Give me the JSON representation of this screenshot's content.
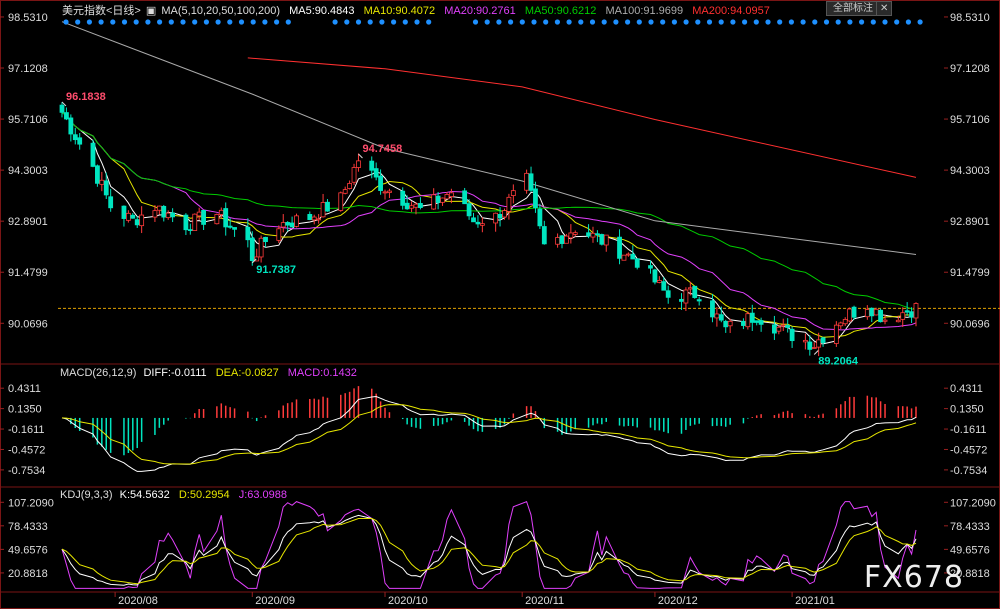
{
  "main_header": {
    "title": "美元指数<日线>",
    "ma_label": "MA(5,10,20,50,100,200)",
    "ma5": "MA5:90.4843",
    "ma10": "MA10:90.4072",
    "ma20": "MA20:90.2761",
    "ma50": "MA50:90.6212",
    "ma100": "MA100:91.9699",
    "ma200": "MA200:94.0957"
  },
  "toolbar": {
    "full_label": "全部标注"
  },
  "macd_header": {
    "label": "MACD(26,12,9)",
    "diff": "DIFF:-0.0111",
    "dea": "DEA:-0.0827",
    "macd": "MACD:0.1432"
  },
  "kdj_header": {
    "label": "KDJ(9,3,3)",
    "k": "K:54.5632",
    "d": "D:50.2954",
    "j": "J:63.0988"
  },
  "watermark": "FX678",
  "colors": {
    "up": "#ff3b3b",
    "down": "#00e5c0",
    "ma5": "#ffffff",
    "ma10": "#e6e600",
    "ma20": "#e040fb",
    "ma50": "#00cc00",
    "ma100": "#aaaaaa",
    "ma200": "#ff3030",
    "last_line": "#e0a000",
    "dots": "#1e90ff"
  },
  "chart_data": [
    {
      "type": "candlestick",
      "title": "美元指数<日线>",
      "y_ticks": [
        "98.5310",
        "97.1208",
        "95.7106",
        "94.3003",
        "92.8901",
        "91.4799",
        "90.0696"
      ],
      "ylim": [
        89.0,
        98.53
      ],
      "x_ticks": [
        "2020/08",
        "2020/09",
        "2020/10",
        "2020/11",
        "2020/12",
        "2021/01"
      ],
      "annotations": [
        {
          "text": "96.1838",
          "value": 96.1838,
          "date": "2020-07-20"
        },
        {
          "text": "94.7458",
          "value": 94.7458,
          "date": "2020-09-25"
        },
        {
          "text": "91.7387",
          "value": 91.7387,
          "date": "2020-09-01"
        },
        {
          "text": "89.2064",
          "value": 89.2064,
          "date": "2021-01-06"
        }
      ],
      "last_price": 90.48,
      "close_series": [
        {
          "date": "2020-07-20",
          "value": 95.9
        },
        {
          "date": "2020-07-27",
          "value": 94.4
        },
        {
          "date": "2020-07-31",
          "value": 93.3
        },
        {
          "date": "2020-08-05",
          "value": 92.9
        },
        {
          "date": "2020-08-10",
          "value": 93.3
        },
        {
          "date": "2020-08-17",
          "value": 92.8
        },
        {
          "date": "2020-08-24",
          "value": 93.1
        },
        {
          "date": "2020-08-31",
          "value": 92.3
        },
        {
          "date": "2020-09-01",
          "value": 91.9
        },
        {
          "date": "2020-09-07",
          "value": 92.8
        },
        {
          "date": "2020-09-14",
          "value": 93.0
        },
        {
          "date": "2020-09-21",
          "value": 93.5
        },
        {
          "date": "2020-09-25",
          "value": 94.6
        },
        {
          "date": "2020-09-30",
          "value": 93.9
        },
        {
          "date": "2020-10-09",
          "value": 93.2
        },
        {
          "date": "2020-10-16",
          "value": 93.7
        },
        {
          "date": "2020-10-21",
          "value": 92.9
        },
        {
          "date": "2020-10-26",
          "value": 93.0
        },
        {
          "date": "2020-11-02",
          "value": 94.0
        },
        {
          "date": "2020-11-06",
          "value": 92.2
        },
        {
          "date": "2020-11-13",
          "value": 92.7
        },
        {
          "date": "2020-11-20",
          "value": 92.3
        },
        {
          "date": "2020-11-27",
          "value": 91.8
        },
        {
          "date": "2020-12-04",
          "value": 90.8
        },
        {
          "date": "2020-12-11",
          "value": 90.9
        },
        {
          "date": "2020-12-17",
          "value": 89.9
        },
        {
          "date": "2020-12-24",
          "value": 90.3
        },
        {
          "date": "2020-12-31",
          "value": 89.8
        },
        {
          "date": "2021-01-06",
          "value": 89.5
        },
        {
          "date": "2021-01-12",
          "value": 90.2
        },
        {
          "date": "2021-01-18",
          "value": 90.6
        },
        {
          "date": "2021-01-22",
          "value": 90.2
        },
        {
          "date": "2021-01-29",
          "value": 90.5
        }
      ],
      "series": [
        {
          "name": "MA5",
          "color": "#ffffff"
        },
        {
          "name": "MA10",
          "color": "#e6e600"
        },
        {
          "name": "MA20",
          "color": "#e040fb"
        },
        {
          "name": "MA50",
          "color": "#00cc00"
        },
        {
          "name": "MA100",
          "color": "#aaaaaa",
          "values": [
            {
              "date": "2020-07-20",
              "value": 98.4
            },
            {
              "date": "2020-09-01",
              "value": 96.4
            },
            {
              "date": "2020-10-01",
              "value": 94.9
            },
            {
              "date": "2020-11-01",
              "value": 94.0
            },
            {
              "date": "2020-12-01",
              "value": 92.9
            },
            {
              "date": "2021-01-29",
              "value": 91.97
            }
          ]
        },
        {
          "name": "MA200",
          "color": "#ff3030",
          "values": [
            {
              "date": "2020-08-31",
              "value": 97.4
            },
            {
              "date": "2020-10-01",
              "value": 97.1
            },
            {
              "date": "2020-11-01",
              "value": 96.6
            },
            {
              "date": "2020-12-01",
              "value": 95.7
            },
            {
              "date": "2021-01-29",
              "value": 94.1
            }
          ]
        }
      ]
    },
    {
      "type": "bar",
      "title": "MACD(26,12,9)",
      "y_ticks": [
        "0.4311",
        "0.1350",
        "-0.1611",
        "-0.4572",
        "-0.7534"
      ],
      "ylim": [
        -0.9,
        0.55
      ],
      "series": [
        {
          "name": "DIFF",
          "color": "#ffffff",
          "last": -0.0111
        },
        {
          "name": "DEA",
          "color": "#e6e600",
          "last": -0.0827
        },
        {
          "name": "MACD",
          "color": "#e040fb",
          "last": 0.1432
        }
      ]
    },
    {
      "type": "line",
      "title": "KDJ(9,3,3)",
      "y_ticks": [
        "107.2090",
        "78.4333",
        "49.6576",
        "20.8818"
      ],
      "ylim": [
        0,
        110
      ],
      "series": [
        {
          "name": "K",
          "color": "#ffffff",
          "last": 54.5632
        },
        {
          "name": "D",
          "color": "#e6e600",
          "last": 50.2954
        },
        {
          "name": "J",
          "color": "#e040fb",
          "last": 63.0988
        }
      ]
    }
  ]
}
